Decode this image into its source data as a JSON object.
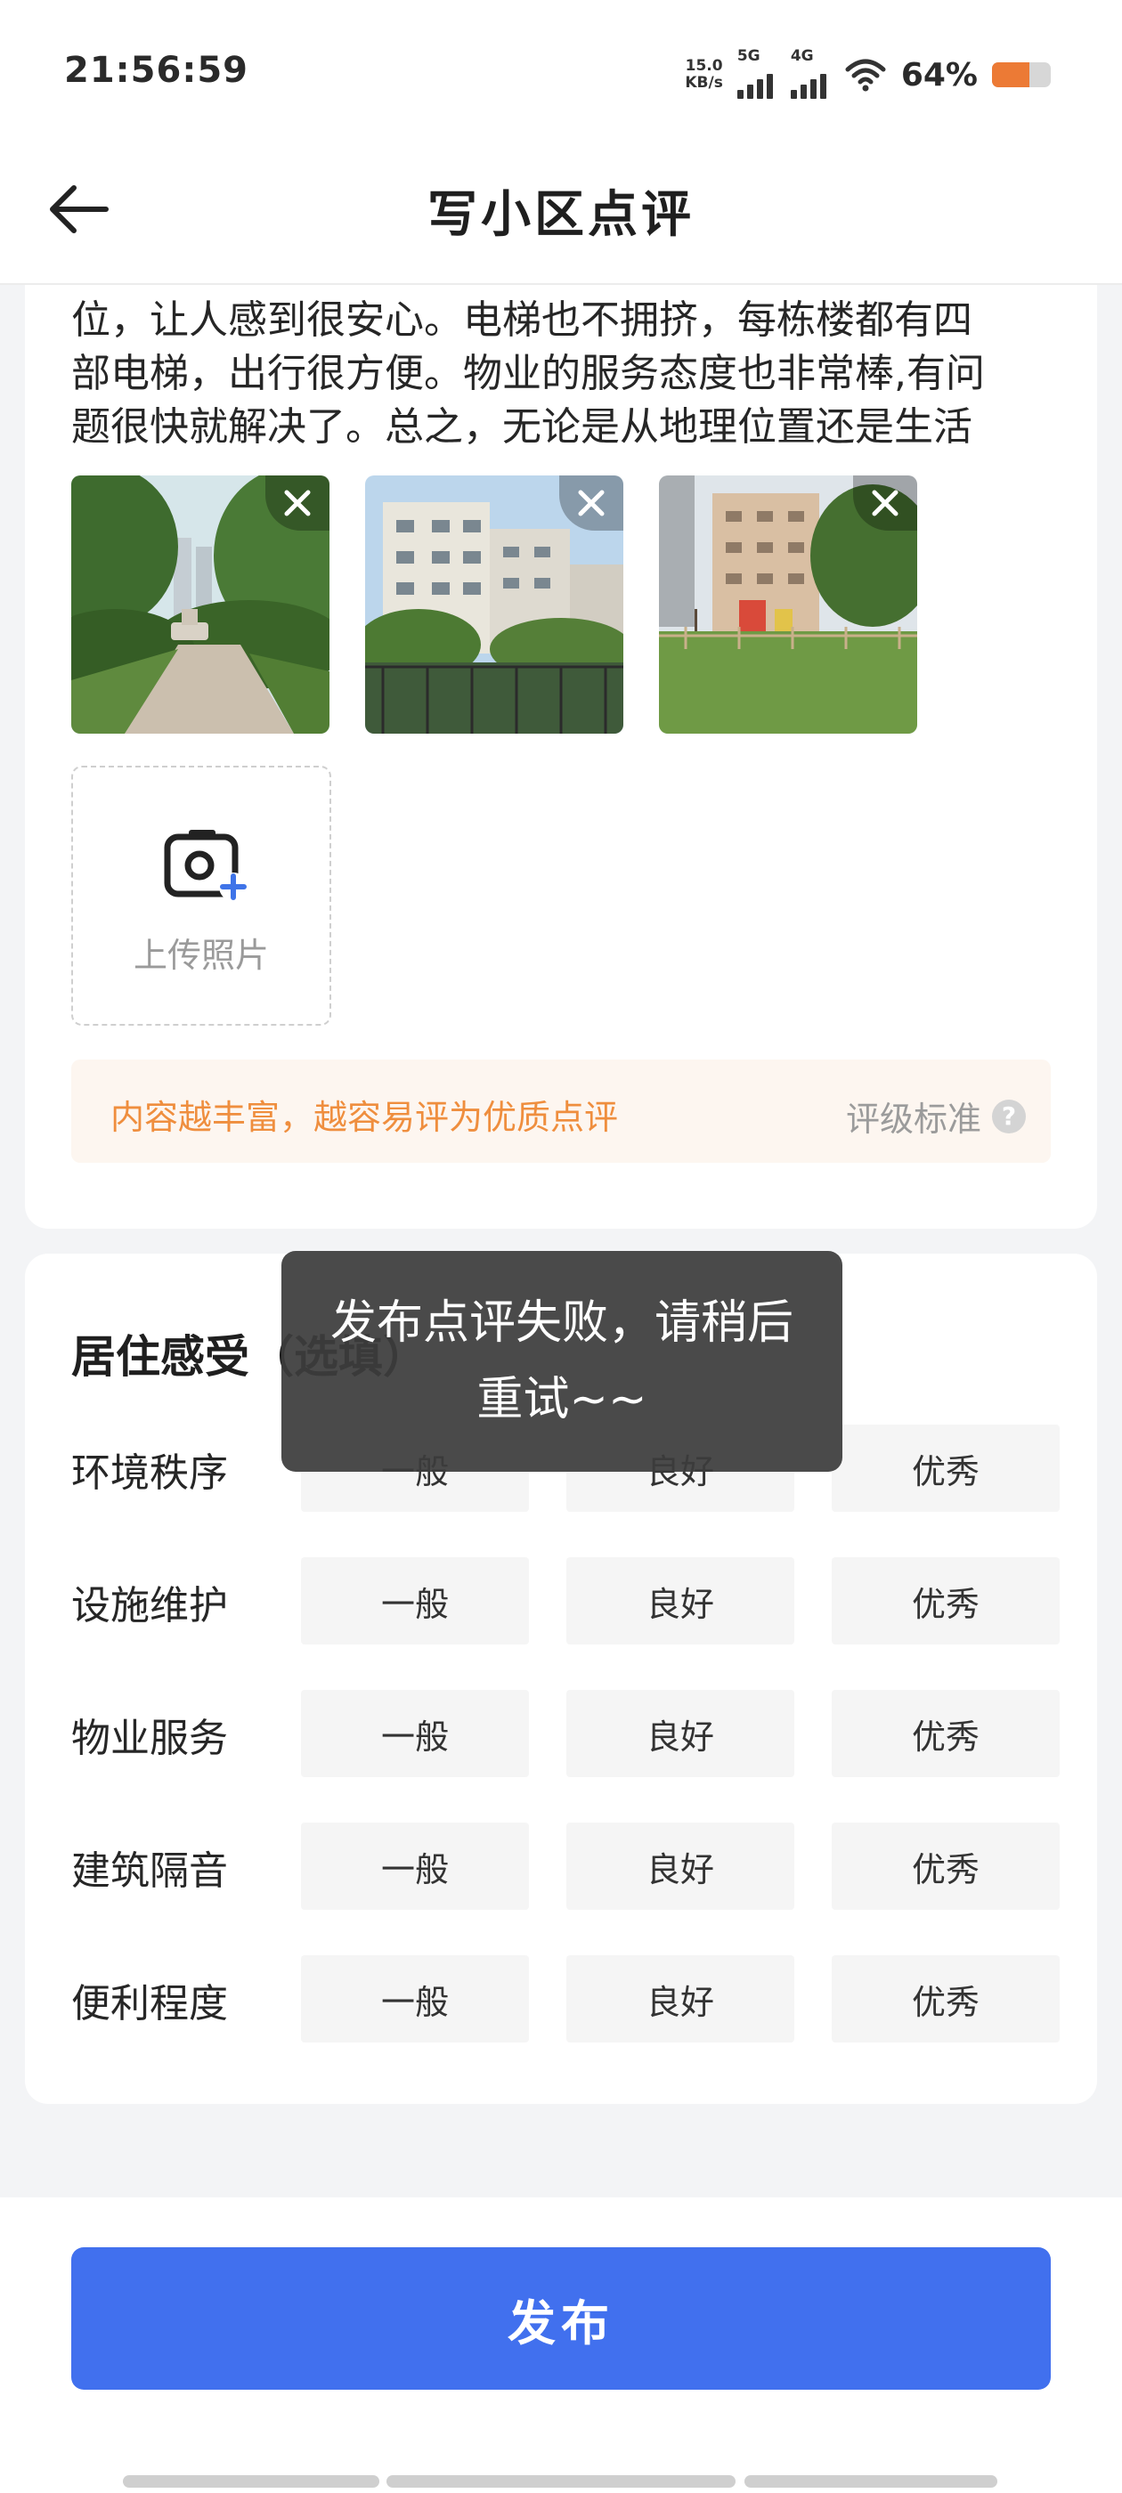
{
  "status_bar": {
    "time": "21:56:59",
    "net_speed_value": "15.0",
    "net_speed_unit": "KB/s",
    "signal_1_label": "5G",
    "signal_2_label": "4G",
    "battery": "64%",
    "battery_level": 0.64,
    "battery_color": "#ec7a35"
  },
  "header": {
    "back_icon": "arrow-left-icon",
    "title": "写小区点评"
  },
  "review": {
    "text": "位，让人感到很安心。电梯也不拥挤，每栋楼都有四\n部电梯，出行很方便。物业的服务态度也非常棒,有问\n题很快就解决了。总之，无论是从地理位置还是生活",
    "photos": [
      {
        "subject": "garden walkway with fountain",
        "remove_icon": "close-icon"
      },
      {
        "subject": "apartment buildings with pond",
        "remove_icon": "close-icon"
      },
      {
        "subject": "lawn and playground by high-rise",
        "remove_icon": "close-icon"
      }
    ],
    "upload_label": "上传照片",
    "upload_icon": "camera-plus-icon"
  },
  "tip": {
    "text": "内容越丰富，越容易评为优质点评",
    "link": "评级标准",
    "help_icon": "question-circle-icon",
    "text_color": "#ef8e3e"
  },
  "rating": {
    "title": "居住感受（选填）",
    "rows": [
      {
        "label": "环境秩序",
        "options": [
          "一般",
          "良好",
          "优秀"
        ]
      },
      {
        "label": "设施维护",
        "options": [
          "一般",
          "良好",
          "优秀"
        ]
      },
      {
        "label": "物业服务",
        "options": [
          "一般",
          "良好",
          "优秀"
        ]
      },
      {
        "label": "建筑隔音",
        "options": [
          "一般",
          "良好",
          "优秀"
        ]
      },
      {
        "label": "便利程度",
        "options": [
          "一般",
          "良好",
          "优秀"
        ]
      }
    ]
  },
  "toast": {
    "message": "发布点评失败，请稍后重试~~"
  },
  "footer": {
    "publish_label": "发布",
    "accent": "#4170ee"
  }
}
